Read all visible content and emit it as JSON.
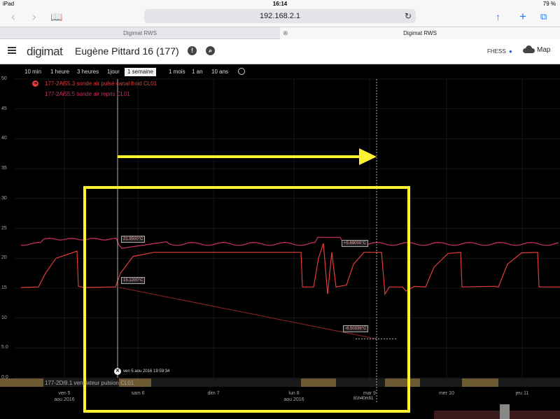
{
  "statusbar": {
    "device": "iPad",
    "time": "16:14",
    "battery": "79 %"
  },
  "browser": {
    "url": "192.168.2.1",
    "tabs": [
      {
        "label": "Digimat RWS"
      },
      {
        "label": "Digimat RWS"
      }
    ]
  },
  "header": {
    "logo": "digimat",
    "site": "Eugène Pittard 16 (177)",
    "user": "FHESS",
    "map_label": "Map"
  },
  "ranges": [
    {
      "label": "10 min"
    },
    {
      "label": "1 heure"
    },
    {
      "label": "3 heures"
    },
    {
      "label": "1jour"
    },
    {
      "label": "1 semaine",
      "active": true
    },
    {
      "label": "1 mois"
    },
    {
      "label": "1 an"
    },
    {
      "label": "10 ans"
    }
  ],
  "legend": [
    {
      "label": "177-2Ai55.3  sonde air pulsé canal froid CL01",
      "color": "#e33c3c"
    },
    {
      "label": "177-2Ai55.5  sonde air repris CL01",
      "color": "#d03060"
    }
  ],
  "chart_data": {
    "type": "line",
    "yticks": [
      "50",
      "45",
      "40",
      "35",
      "30",
      "25",
      "20",
      "15",
      "10",
      "5.0",
      "0.0"
    ],
    "xticks": [
      {
        "day": "ven 5",
        "month": "aou 2016"
      },
      {
        "day": "sam 6",
        "month": ""
      },
      {
        "day": "dim 7",
        "month": ""
      },
      {
        "day": "lun 8",
        "month": "aou 2016"
      },
      {
        "day": "mar 9",
        "month": ""
      },
      {
        "day": "mer 10",
        "month": ""
      },
      {
        "day": "jeu 11",
        "month": ""
      }
    ],
    "ylim": [
      0,
      50
    ],
    "annotations": {
      "a1": "21.9500°C",
      "a2": "15.1200°C",
      "a3": "+5.69000°C",
      "a4": "-6.50336°C"
    },
    "cursor": {
      "timestamp": "ven 5 aou 2016 19:59:34",
      "elapsed": "81h40m51"
    },
    "digital_series": "177-2Di9.1  ventilateur pulsion CL01",
    "colors": {
      "supply": "#e33c3c",
      "return": "#d03060",
      "digital": "#6b5a32",
      "overlay": "#fff231"
    }
  }
}
